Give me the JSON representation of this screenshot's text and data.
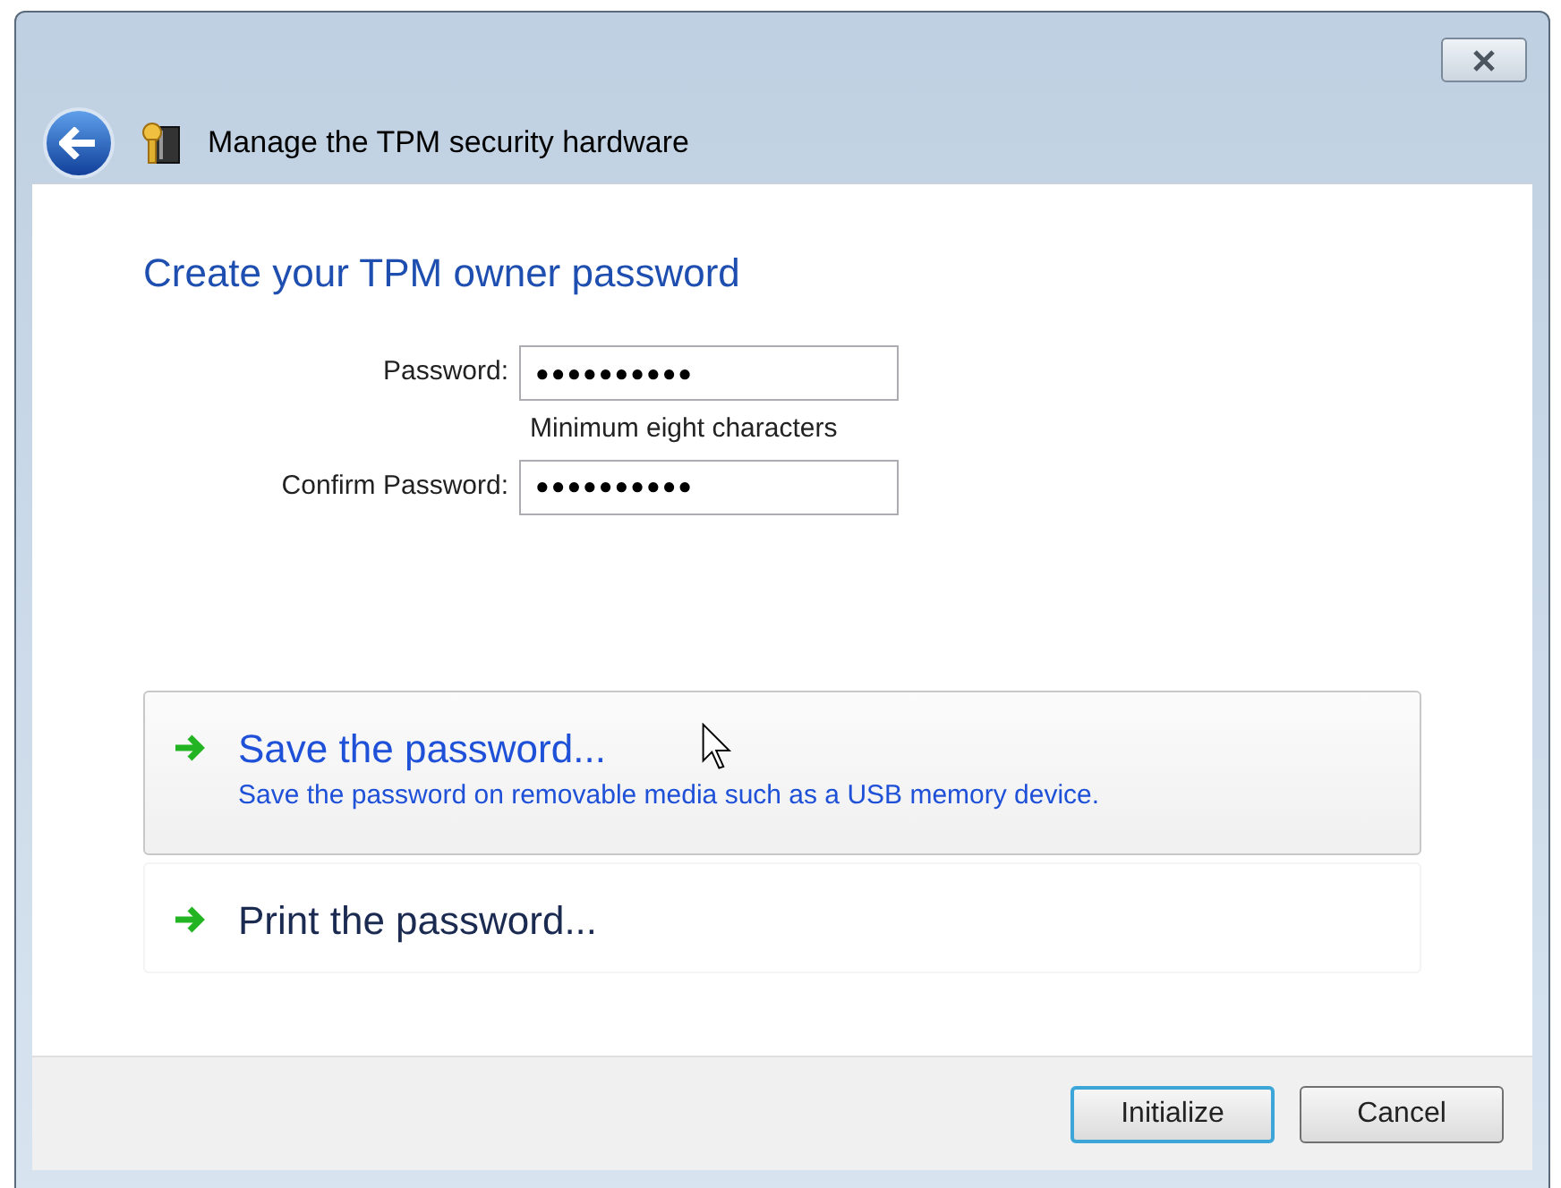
{
  "window": {
    "title": "Manage the TPM security hardware"
  },
  "heading": "Create your TPM owner password",
  "fields": [
    {
      "label": "Password:",
      "value": "●●●●●●●●●●",
      "hint": "Minimum eight characters"
    },
    {
      "label": "Confirm Password:",
      "value": "●●●●●●●●●●"
    }
  ],
  "options": [
    {
      "title": "Save the password...",
      "description": "Save the password on removable media such as a USB memory device.",
      "hovered": true
    },
    {
      "title": "Print the password...",
      "hovered": false
    }
  ],
  "buttons": [
    {
      "label": "Initialize",
      "default": true
    },
    {
      "label": "Cancel",
      "default": false
    }
  ]
}
